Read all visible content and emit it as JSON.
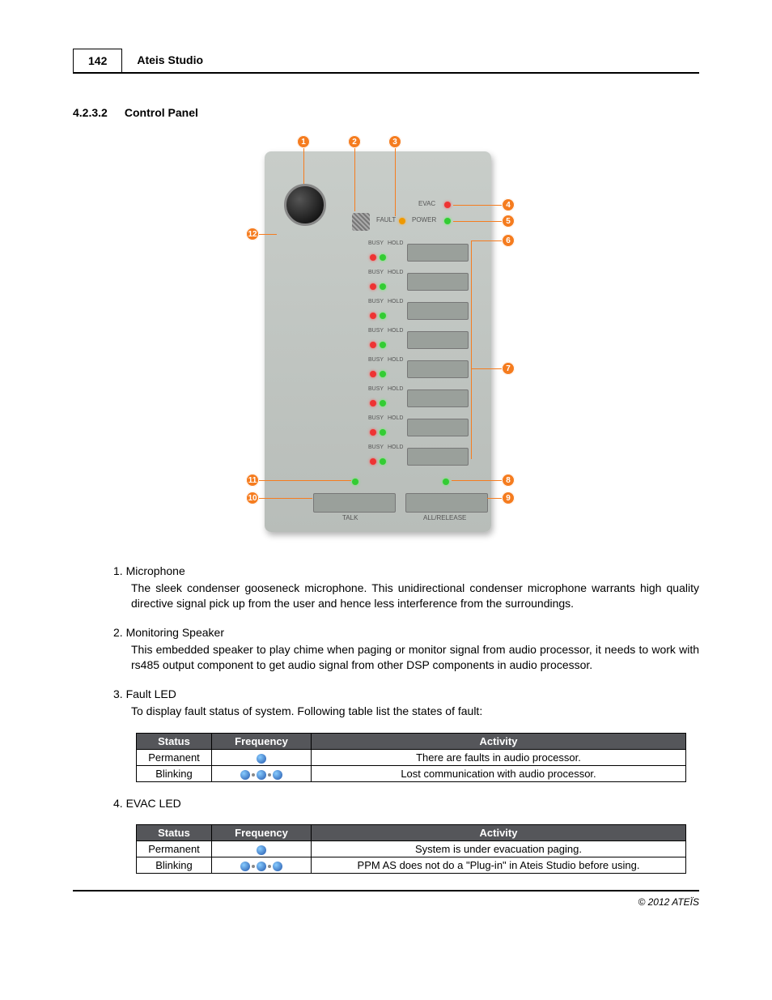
{
  "header": {
    "page_number": "142",
    "title": "Ateis Studio"
  },
  "section": {
    "number": "4.2.3.2",
    "title": "Control Panel"
  },
  "diagram": {
    "labels": {
      "fault": "FAULT",
      "evac": "EVAC",
      "power": "POWER",
      "busy": "BUSY",
      "hold": "HOLD",
      "talk": "TALK",
      "all_release": "ALL/RELEASE"
    },
    "callouts": [
      "1",
      "2",
      "3",
      "4",
      "5",
      "6",
      "7",
      "8",
      "9",
      "10",
      "11",
      "12"
    ]
  },
  "items": [
    {
      "num": "1.",
      "title": "Microphone",
      "desc": "The sleek condenser gooseneck microphone. This unidirectional condenser microphone warrants high quality directive signal pick up from the user and hence less interference from the surroundings."
    },
    {
      "num": "2.",
      "title": "Monitoring Speaker",
      "desc": "This embedded speaker to play chime when paging or monitor signal from audio processor, it needs to work with rs485 output component to get audio signal from other DSP components in audio processor."
    },
    {
      "num": "3.",
      "title": "Fault LED",
      "desc": "To display fault status of system. Following table list the states of fault:"
    },
    {
      "num": "4.",
      "title": "EVAC LED",
      "desc": ""
    }
  ],
  "tables": {
    "headers": {
      "status": "Status",
      "frequency": "Frequency",
      "activity": "Activity"
    },
    "fault": [
      {
        "status": "Permanent",
        "freq": "single",
        "activity": "There are faults in audio processor."
      },
      {
        "status": "Blinking",
        "freq": "triple",
        "activity": "Lost communication with audio processor."
      }
    ],
    "evac": [
      {
        "status": "Permanent",
        "freq": "single",
        "activity": "System is under evacuation paging."
      },
      {
        "status": "Blinking",
        "freq": "triple",
        "activity": "PPM AS does not do a \"Plug-in\" in Ateis Studio before using."
      }
    ]
  },
  "footer": "© 2012 ATEÏS"
}
